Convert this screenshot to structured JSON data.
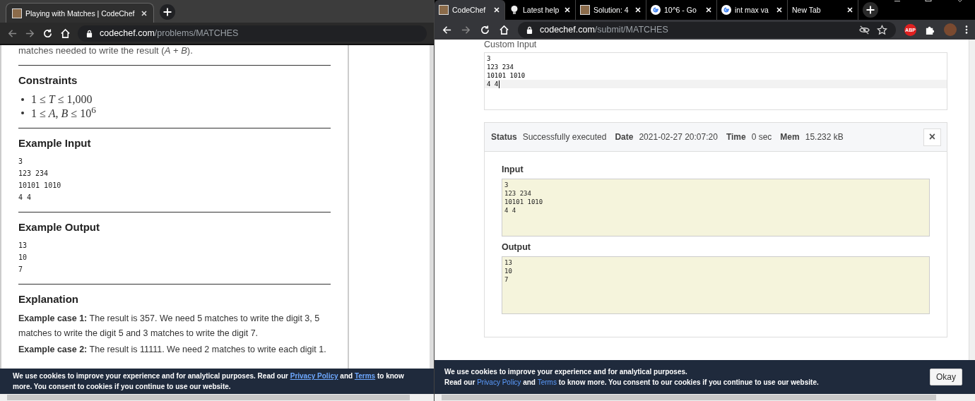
{
  "left_window": {
    "tabs": [
      {
        "label": "Playing with Matches | CodeChef",
        "kind": "codechef",
        "selected": true
      }
    ],
    "url": {
      "host": "codechef.com",
      "path": "/problems/MATCHES"
    },
    "intro": "matches needed to write the result (*A* + *B*).",
    "sections": [
      {
        "heading": "Constraints",
        "kind": "list",
        "items": [
          "1 ≤ *T* ≤ 1,000",
          "1 ≤ *A*, *B* ≤ 10$^{6}$"
        ]
      },
      {
        "heading": "Example Input",
        "kind": "code",
        "text": "3\n123 234\n10101 1010\n4 4"
      },
      {
        "heading": "Example Output",
        "kind": "code",
        "text": "13\n10\n7"
      },
      {
        "heading": "Explanation",
        "kind": "paragraphs",
        "items": [
          "**Example case 1:** The result is 357. We need 5 matches to write the digit 3, 5 matches to write the digit 5 and 3 matches to write the digit 7.",
          "**Example case 2:** The result is 11111. We need 2 matches to write each digit 1."
        ]
      }
    ],
    "cookie_banner": {
      "before": "We use cookies to improve your experience and for analytical purposes. Read our",
      "link_1": "Privacy Policy",
      "middle": "and",
      "link_2": "Terms",
      "after": "to know more. You consent to cookies if you continue to use our website."
    }
  },
  "right_window": {
    "tabs": [
      {
        "label": "CodeChef",
        "kind": "codechef",
        "selected": true
      },
      {
        "label": "Latest help",
        "kind": "bulb",
        "selected": false
      },
      {
        "label": "Solution: 4",
        "kind": "codechef",
        "selected": false
      },
      {
        "label": "10^6 - Go",
        "kind": "google",
        "selected": false
      },
      {
        "label": "int max va",
        "kind": "google",
        "selected": false
      },
      {
        "label": "New Tab",
        "kind": "plain",
        "selected": false
      }
    ],
    "url": {
      "host": "codechef.com",
      "path": "/submit/MATCHES"
    },
    "adblock_label": "ABP",
    "custom_input": {
      "label": "Custom Input",
      "lines": [
        {
          "text": "3",
          "current": false
        },
        {
          "text": "123 234",
          "current": false
        },
        {
          "text": "10101 1010",
          "current": false
        },
        {
          "text": "4 4",
          "current": true
        }
      ]
    },
    "result": {
      "fields": [
        {
          "label": "Status",
          "value": "Successfully executed"
        },
        {
          "label": "Date",
          "value": "2021-02-27 20:07:20"
        },
        {
          "label": "Time",
          "value": "0 sec"
        },
        {
          "label": "Mem",
          "value": "15.232 kB"
        }
      ],
      "close_label": "×",
      "input": {
        "label": "Input",
        "text": "3\n123 234\n10101 1010\n4 4"
      },
      "output": {
        "label": "Output",
        "text": "13\n10\n7"
      }
    },
    "cookie_banner": {
      "line_1": "We use cookies to improve your experience and for analytical purposes.",
      "before": "Read our",
      "link_1": "Privacy Policy",
      "middle": "and",
      "link_2": "Terms",
      "after": "to know more. You consent to our cookies if you continue to use our website.",
      "button": "Okay"
    }
  }
}
